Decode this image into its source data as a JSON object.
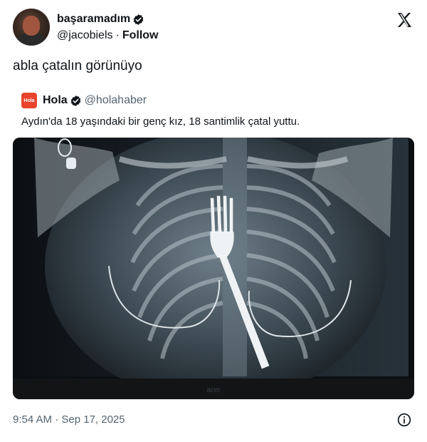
{
  "author": {
    "display_name": "başaramadım",
    "handle": "@jacobiels",
    "follow_label": "Follow",
    "separator": "·"
  },
  "tweet": {
    "text": "abla çatalın görünüyo",
    "timestamp": "9:54 AM · Sep 17, 2025"
  },
  "quoted": {
    "logo_text": "Hola",
    "name": "Hola",
    "handle": "@holahaber",
    "text": "Aydın'da 18 yaşındaki bir genç kız, 18 santimlik çatal yuttu.",
    "image_caption": "acer"
  },
  "colors": {
    "verified": "#0f1419",
    "hola_brand": "#e8442c",
    "muted": "#536471"
  },
  "icons": {
    "verified": "verified-badge-icon",
    "platform": "x-logo-icon",
    "info": "info-icon"
  }
}
